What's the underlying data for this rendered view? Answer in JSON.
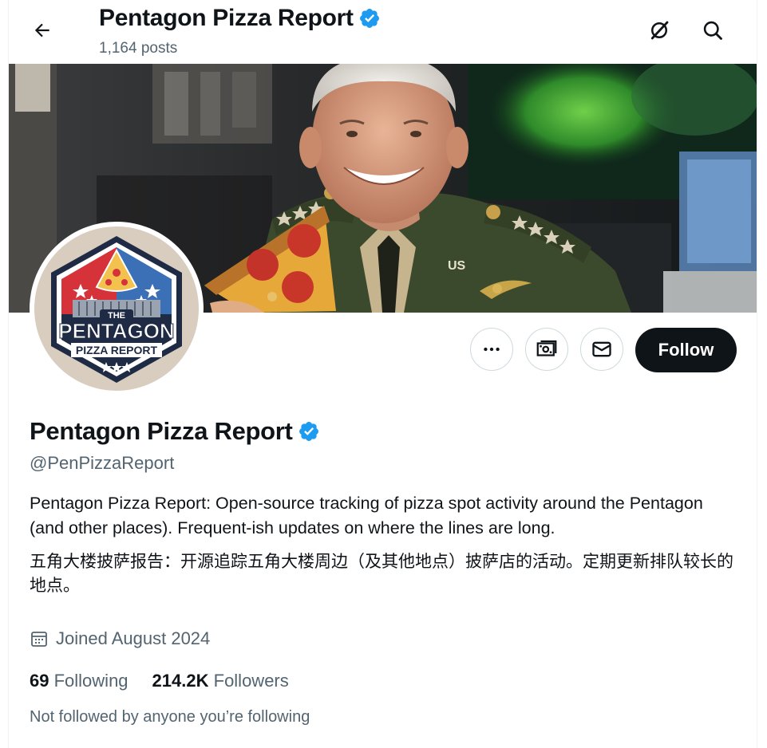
{
  "header": {
    "title": "Pentagon Pizza Report",
    "posts": "1,164 posts"
  },
  "profile": {
    "name": "Pentagon Pizza Report",
    "handle": "@PenPizzaReport",
    "bio_en": "Pentagon Pizza Report: Open-source tracking of pizza spot activity around the Pentagon (and other places). Frequent-ish updates on where the lines are long.",
    "bio_cn": "五角大楼披萨报告：开源追踪五角大楼周边（及其他地点）披萨店的活动。定期更新排队较长的地点。",
    "joined": "Joined August 2024",
    "following_count": "69",
    "following_label": "Following",
    "followers_count": "214.2K",
    "followers_label": "Followers",
    "not_followed": "Not followed by anyone you’re following"
  },
  "actions": {
    "follow_label": "Follow"
  },
  "avatar_logo": {
    "line1": "THE",
    "line2": "PENTAGON",
    "line3": "PIZZA REPORT"
  },
  "banner_text": {
    "uniform_tag": "US"
  },
  "colors": {
    "verified": "#1d9bf0",
    "text_primary": "#0f1419",
    "text_secondary": "#536471",
    "follow_bg": "#0f1419"
  },
  "icons": [
    "back-arrow-icon",
    "verified-badge-icon",
    "grok-icon",
    "search-icon",
    "more-icon",
    "subscribe-icon",
    "message-icon",
    "calendar-icon"
  ]
}
